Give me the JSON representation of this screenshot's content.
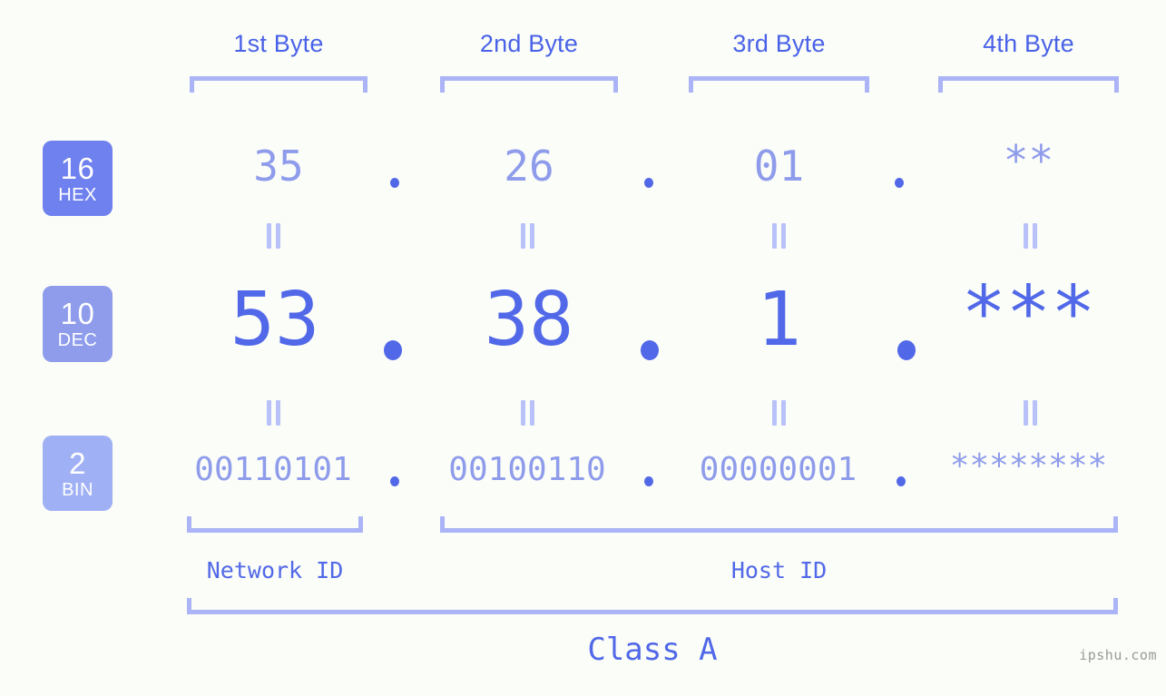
{
  "background_color": "#fbfdf8",
  "accent_colors": {
    "label_blue": "#4a62e8",
    "value_light_blue": "#8e9ceb",
    "value_strong_blue": "#5168e8",
    "bracket_blue": "#aab4f7",
    "equals_blue": "#b8c2f9",
    "badge_hex": "#6f81ef",
    "badge_dec": "#8e9ceb",
    "badge_bin": "#9fb0f5",
    "watermark_gray": "#9a9a9a"
  },
  "byte_headers": [
    {
      "label": "1st Byte"
    },
    {
      "label": "2nd Byte"
    },
    {
      "label": "3rd Byte"
    },
    {
      "label": "4th Byte"
    }
  ],
  "bases": [
    {
      "number": "16",
      "name": "HEX"
    },
    {
      "number": "10",
      "name": "DEC"
    },
    {
      "number": "2",
      "name": "BIN"
    }
  ],
  "rows": {
    "hex": {
      "base": "16",
      "base_name": "HEX",
      "values": [
        "35",
        "26",
        "01",
        "**"
      ],
      "separator": "."
    },
    "dec": {
      "base": "10",
      "base_name": "DEC",
      "values": [
        "53",
        "38",
        "1",
        "***"
      ],
      "separator": "."
    },
    "bin": {
      "base": "2",
      "base_name": "BIN",
      "values": [
        "00110101",
        "00100110",
        "00000001",
        "********"
      ],
      "separator": "."
    }
  },
  "equals_symbol": "=",
  "segments": {
    "network_id": "Network ID",
    "host_id": "Host ID",
    "class": "Class A"
  },
  "watermark": "ipshu.com"
}
